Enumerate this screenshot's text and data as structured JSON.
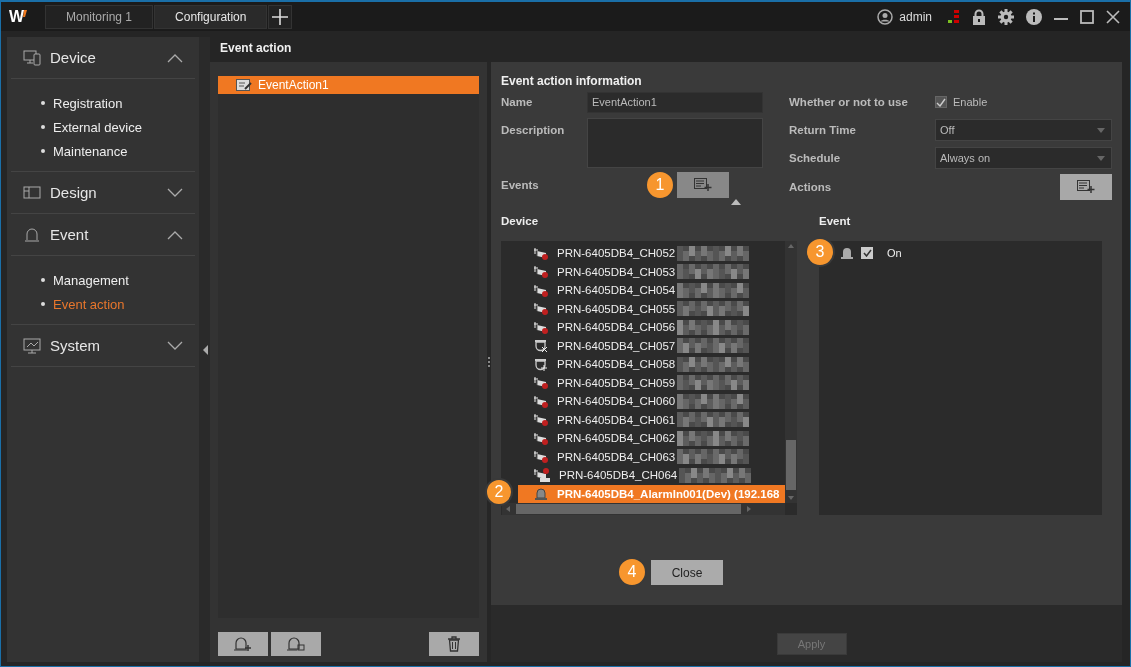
{
  "window": {
    "logo": "W",
    "tabs": [
      {
        "label": "Monitoring 1",
        "selected": false
      },
      {
        "label": "Configuration",
        "selected": true
      }
    ],
    "user": "admin"
  },
  "sidebar": {
    "sections": [
      {
        "label": "Device",
        "expanded": true,
        "items": [
          {
            "label": "Registration",
            "selected": false
          },
          {
            "label": "External device",
            "selected": false
          },
          {
            "label": "Maintenance",
            "selected": false
          }
        ]
      },
      {
        "label": "Design",
        "expanded": false
      },
      {
        "label": "Event",
        "expanded": true,
        "items": [
          {
            "label": "Management",
            "selected": false
          },
          {
            "label": "Event action",
            "selected": true
          }
        ]
      },
      {
        "label": "System",
        "expanded": false
      }
    ]
  },
  "page_title": "Event action",
  "action_list": [
    {
      "label": "EventAction1",
      "selected": true
    }
  ],
  "info": {
    "title": "Event action information",
    "name_label": "Name",
    "name_value": "EventAction1",
    "description_label": "Description",
    "events_label": "Events",
    "use_label": "Whether or not to use",
    "use_checkbox": {
      "label": "Enable",
      "checked": true
    },
    "return_label": "Return Time",
    "return_value": "Off",
    "schedule_label": "Schedule",
    "schedule_value": "Always on",
    "actions_label": "Actions"
  },
  "device": {
    "title": "Device",
    "rows": [
      {
        "label": "PRN-6405DB4_CH052",
        "kind": "camera",
        "redacted": true,
        "selected": false
      },
      {
        "label": "PRN-6405DB4_CH053",
        "kind": "camera",
        "redacted": true,
        "selected": false
      },
      {
        "label": "PRN-6405DB4_CH054",
        "kind": "camera",
        "redacted": true,
        "selected": false
      },
      {
        "label": "PRN-6405DB4_CH055",
        "kind": "camera",
        "redacted": true,
        "selected": false
      },
      {
        "label": "PRN-6405DB4_CH056",
        "kind": "camera",
        "redacted": true,
        "selected": false
      },
      {
        "label": "PRN-6405DB4_CH057",
        "kind": "dome-off",
        "redacted": true,
        "selected": false
      },
      {
        "label": "PRN-6405DB4_CH058",
        "kind": "dome",
        "redacted": true,
        "selected": false
      },
      {
        "label": "PRN-6405DB4_CH059",
        "kind": "camera",
        "redacted": true,
        "selected": false
      },
      {
        "label": "PRN-6405DB4_CH060",
        "kind": "camera",
        "redacted": true,
        "selected": false
      },
      {
        "label": "PRN-6405DB4_CH061",
        "kind": "camera",
        "redacted": true,
        "selected": false
      },
      {
        "label": "PRN-6405DB4_CH062",
        "kind": "camera",
        "redacted": true,
        "selected": false
      },
      {
        "label": "PRN-6405DB4_CH063",
        "kind": "camera",
        "redacted": true,
        "selected": false
      },
      {
        "label": "PRN-6405DB4_CH064",
        "kind": "camera-360",
        "redacted": true,
        "selected": false
      },
      {
        "label": "PRN-6405DB4_AlarmIn001(Dev) (192.168",
        "kind": "alarm",
        "redacted": false,
        "selected": true
      }
    ]
  },
  "event": {
    "title": "Event",
    "rows": [
      {
        "label": "On",
        "checked": true
      }
    ]
  },
  "close_button": "Close",
  "apply_button": {
    "label": "Apply",
    "disabled": true
  },
  "callouts": [
    "1",
    "2",
    "3",
    "4"
  ]
}
